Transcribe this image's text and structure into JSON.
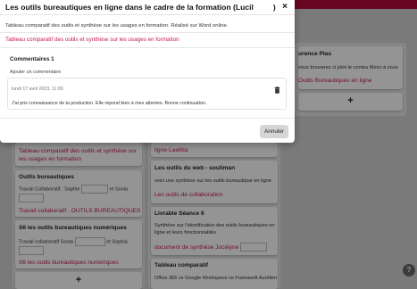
{
  "modal": {
    "title_left": "Les outils bureautiques en ligne dans le cadre de la formation (Lucil",
    "title_right": ")",
    "close_label": "×",
    "description": "Tableau comparatif des outils et synthèse sur les usages en formation. Réalisé sur Word online.",
    "document_link": "Tableau comparatif des outils et synthèse sur les usages en formation",
    "comments_heading": "Commentaires 1",
    "add_comment_label": "Ajouter un commentaire",
    "comment": {
      "date": "lundi 17 avril 2023, 11:00",
      "text": "J'ai pris connaissance de ta production. Elle répond bien à mes attentes. Bonne continuation."
    },
    "cancel_label": "Annuler",
    "trash_icon": "trash-icon"
  },
  "board": {
    "accent_color": "#b40a3a",
    "link_color": "#c2185b",
    "right_column": {
      "card_title": "urence Plas",
      "card_text": "vous trouverez ci joint le conteu Merci à vous",
      "card_link": "Outils Bureautiques en ligne"
    },
    "left_column": {
      "card1_link": "Tableau comparatif des outils et synthèse sur les usages en formation",
      "card2_title": "Outils bureautiques",
      "card2_text_a": "Travail Collaboratif : Sophie",
      "card2_text_b": "et Sonia",
      "card2_link": "Travail collaboratif , OUTILS BUREAUTIQUES",
      "card3_title": "S6 les outils bureautiques numériques",
      "card3_text_a": "Travail collaboratif Sonia",
      "card3_text_b": "et Sophia",
      "card3_link": "S6 les outils bureautiques numériques",
      "add_label": "+"
    },
    "middle_column": {
      "card1_link": "ligne-Laetitia",
      "card2_title": "Les outils du web - souliman",
      "card2_text": "voici une synthèse sur les outils bureautique en ligne",
      "card2_link": "Les outils de collaboration",
      "card3_title": "Livrable Séance 6",
      "card3_text_a": "Synthèse sur l'identification des outils bureautiques en",
      "card3_text_b": "ligne et leurs fonctionnalités",
      "card3_link": "document de synthèse Jocelyne",
      "card4_title": "Tableau comparatif",
      "card4_text": "Office 365 vs Google Workspace vs Framasoft Aurélien"
    },
    "help_label": "?"
  }
}
